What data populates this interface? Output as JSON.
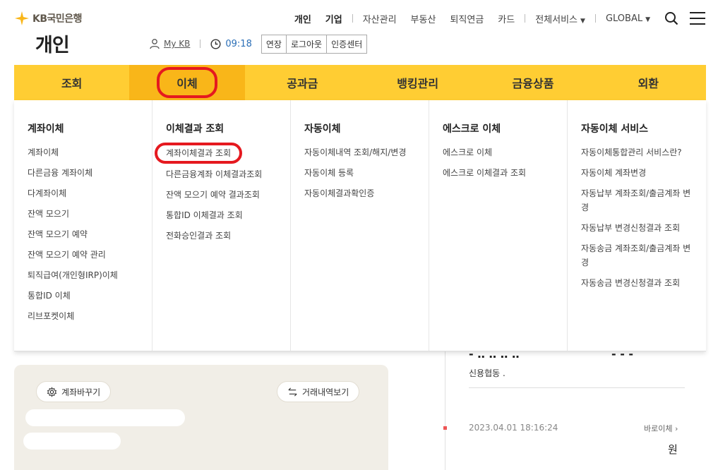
{
  "logo": {
    "text": "KB국민은행"
  },
  "page_title": "개인",
  "top_nav": {
    "items": [
      {
        "label": "개인",
        "bold": true
      },
      {
        "label": "기업",
        "bold": true
      },
      {
        "label": "자산관리"
      },
      {
        "label": "부동산"
      },
      {
        "label": "퇴직연금"
      },
      {
        "label": "카드"
      },
      {
        "label": "전체서비스"
      },
      {
        "label": "GLOBAL"
      }
    ]
  },
  "user_bar": {
    "mykb": "My KB",
    "timer": "09:18",
    "buttons": [
      "연장",
      "로그아웃",
      "인증센터"
    ]
  },
  "gnb": [
    {
      "label": "조회"
    },
    {
      "label": "이체",
      "active": true
    },
    {
      "label": "공과금"
    },
    {
      "label": "뱅킹관리"
    },
    {
      "label": "금융상품"
    },
    {
      "label": "외환"
    }
  ],
  "mega_menu": [
    {
      "title": "계좌이체",
      "items": [
        "계좌이체",
        "다른금융 계좌이체",
        "다계좌이체",
        "잔액 모으기",
        "잔액 모으기 예약",
        "잔액 모으기 예약 관리",
        "퇴직급여(개인형IRP)이체",
        "통합ID 이체",
        "리브포켓이체"
      ]
    },
    {
      "title": "이체결과 조회",
      "items": [
        "계좌이체결과 조회",
        "다른금융계좌 이체결과조회",
        "잔액 모으기 예약 결과조회",
        "통합ID 이체결과 조회",
        "전화승인결과 조회"
      ]
    },
    {
      "title": "자동이체",
      "items": [
        "자동이체내역 조회/해지/변경",
        "자동이체 등록",
        "자동이체결과확인증"
      ]
    },
    {
      "title": "에스크로 이체",
      "items": [
        "에스크로 이체",
        "에스크로 이체결과 조회"
      ]
    },
    {
      "title": "자동이체 서비스",
      "items": [
        "자동이체통합관리 서비스란?",
        "자동이체 계좌변경",
        "자동납부 계좌조회/출금계좌 변경",
        "자동납부 변경신청결과 조회",
        "자동송금 계좌조회/출금계좌 변경",
        "자동송금 변경신청결과 조회"
      ]
    }
  ],
  "background": {
    "change_account": "계좌바꾸기",
    "history": "거래내역보기",
    "credit": "신용협동 .",
    "tx_date": "2023.04.01 18:16:24",
    "quick_transfer": "바로이체 ›",
    "won": "원"
  },
  "colors": {
    "gnb_bg": "#ffcd33",
    "gnb_active": "#f9b619",
    "highlight_circle": "#e5191f",
    "timer": "#2b6fb7"
  }
}
